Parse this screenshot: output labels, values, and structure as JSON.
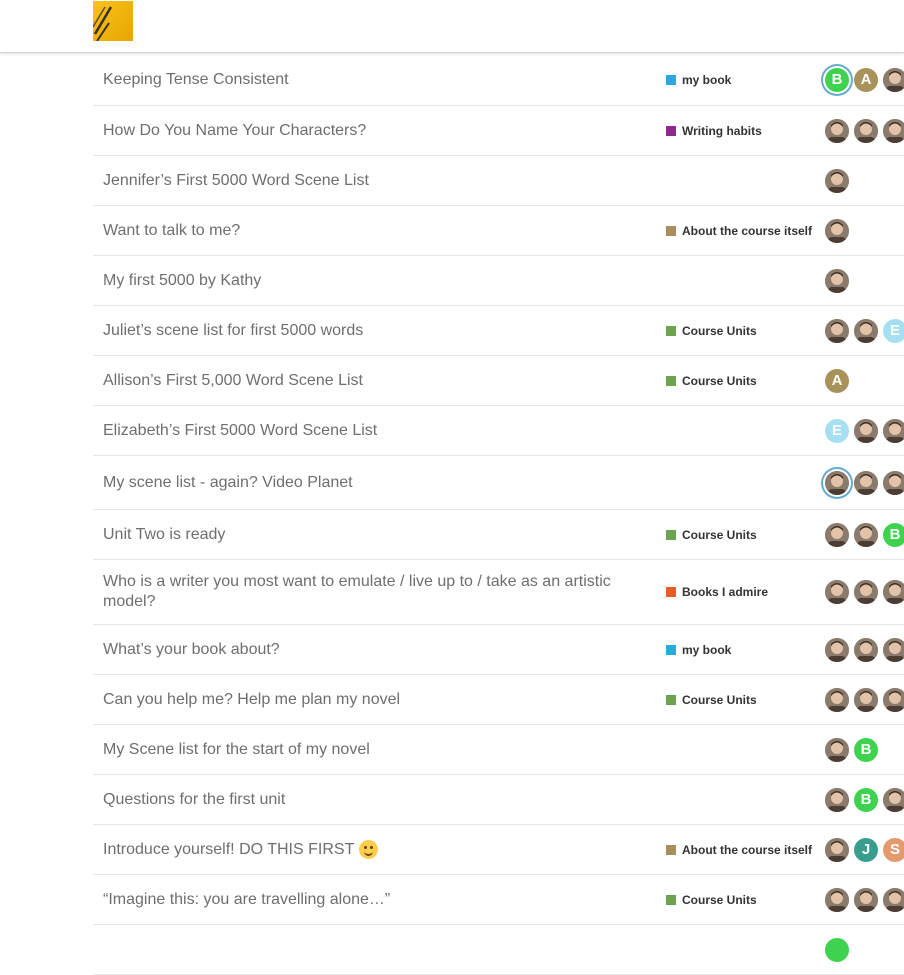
{
  "header": {
    "logo_icon": "pencil-logo-icon"
  },
  "topics": [
    {
      "title": "Keeping Tense Consistent",
      "category": "my book",
      "category_color": "#25aae1",
      "posters": [
        {
          "letter": "B",
          "color": "#3ed24e",
          "ring": true
        },
        {
          "letter": "A",
          "color": "#a8925a"
        },
        {
          "photo": true
        }
      ]
    },
    {
      "title": "How Do You Name Your Characters?",
      "category": "Writing habits",
      "category_color": "#92278f",
      "posters": [
        {
          "photo": true
        },
        {
          "photo": true
        },
        {
          "photo": true
        }
      ]
    },
    {
      "title": "Jennifer’s First 5000 Word Scene List",
      "category": "",
      "category_color": "",
      "posters": [
        {
          "photo": true
        }
      ]
    },
    {
      "title": "Want to talk to me?",
      "category": "About the course itself",
      "category_color": "#a88e5c",
      "posters": [
        {
          "photo": true
        }
      ]
    },
    {
      "title": "My first 5000 by Kathy",
      "category": "",
      "category_color": "",
      "posters": [
        {
          "photo": true
        }
      ]
    },
    {
      "title": "Juliet’s scene list for first 5000 words",
      "category": "Course Units",
      "category_color": "#6ba34e",
      "posters": [
        {
          "photo": true
        },
        {
          "photo": true
        },
        {
          "letter": "E",
          "color": "#a5dff1"
        }
      ]
    },
    {
      "title": "Allison’s First 5,000 Word Scene List",
      "category": "Course Units",
      "category_color": "#6ba34e",
      "posters": [
        {
          "letter": "A",
          "color": "#a8925a"
        }
      ]
    },
    {
      "title": "Elizabeth’s First 5000 Word Scene List",
      "category": "",
      "category_color": "",
      "posters": [
        {
          "letter": "E",
          "color": "#a5dff1"
        },
        {
          "photo": true
        },
        {
          "photo": true
        }
      ]
    },
    {
      "title": "My scene list - again? Video Planet",
      "category": "",
      "category_color": "",
      "posters": [
        {
          "photo": true,
          "ring": true
        },
        {
          "photo": true
        },
        {
          "photo": true
        }
      ]
    },
    {
      "title": "Unit Two is ready",
      "category": "Course Units",
      "category_color": "#6ba34e",
      "posters": [
        {
          "photo": true
        },
        {
          "photo": true
        },
        {
          "letter": "B",
          "color": "#3ed24e"
        }
      ]
    },
    {
      "title": "Who is a writer you most want to emulate / live up to / take as an artistic model?",
      "category": "Books I admire",
      "category_color": "#f15a24",
      "posters": [
        {
          "photo": true
        },
        {
          "photo": true
        },
        {
          "photo": true
        }
      ]
    },
    {
      "title": "What’s your book about?",
      "category": "my book",
      "category_color": "#25aae1",
      "posters": [
        {
          "photo": true
        },
        {
          "photo": true
        },
        {
          "photo": true
        }
      ]
    },
    {
      "title": "Can you help me? Help me plan my novel",
      "category": "Course Units",
      "category_color": "#6ba34e",
      "posters": [
        {
          "photo": true
        },
        {
          "photo": true
        },
        {
          "photo": true
        }
      ]
    },
    {
      "title": "My Scene list for the start of my novel",
      "category": "",
      "category_color": "",
      "posters": [
        {
          "photo": true
        },
        {
          "letter": "B",
          "color": "#3ed24e"
        }
      ]
    },
    {
      "title": "Questions for the first unit",
      "category": "",
      "category_color": "",
      "posters": [
        {
          "photo": true
        },
        {
          "letter": "B",
          "color": "#3ed24e"
        },
        {
          "photo": true
        }
      ]
    },
    {
      "title": "Introduce yourself! DO THIS FIRST",
      "emoji": "slightly-smiling-face-icon",
      "category": "About the course itself",
      "category_color": "#a88e5c",
      "posters": [
        {
          "photo": true
        },
        {
          "letter": "J",
          "color": "#3a9e8f"
        },
        {
          "letter": "S",
          "color": "#e39a6d"
        }
      ]
    },
    {
      "title": "“Imagine this: you are travelling alone…”",
      "category": "Course Units",
      "category_color": "#6ba34e",
      "posters": [
        {
          "photo": true
        },
        {
          "photo": true
        },
        {
          "photo": true
        }
      ]
    },
    {
      "title": "",
      "category": "",
      "category_color": "",
      "posters": [
        {
          "letter": "",
          "color": "#3ed24e"
        }
      ]
    }
  ]
}
